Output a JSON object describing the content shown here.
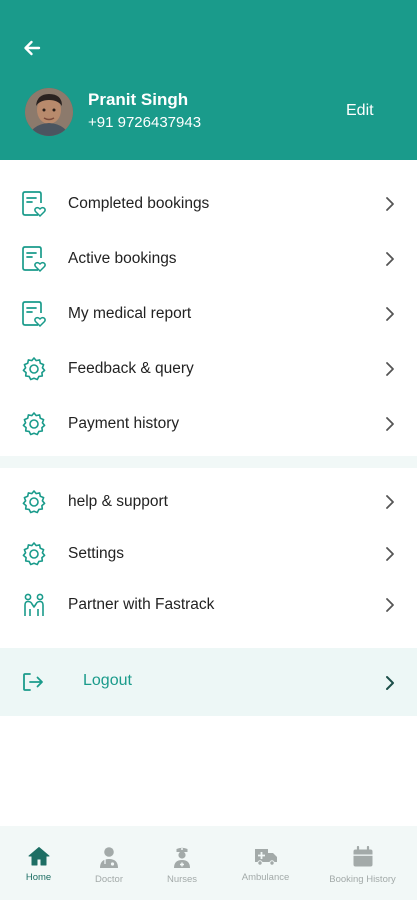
{
  "header": {
    "name": "Pranit Singh",
    "phone": "+91 9726437943",
    "edit_label": "Edit",
    "bg_color": "#1a9b8b"
  },
  "menu_group_1": [
    {
      "label": "Completed bookings",
      "icon": "report-heart-icon"
    },
    {
      "label": "Active bookings",
      "icon": "report-heart-icon"
    },
    {
      "label": "My medical report",
      "icon": "report-heart-icon"
    },
    {
      "label": "Feedback & query",
      "icon": "gear-icon"
    },
    {
      "label": "Payment history",
      "icon": "gear-icon"
    }
  ],
  "menu_group_2": [
    {
      "label": "help & support",
      "icon": "gear-icon"
    },
    {
      "label": "Settings",
      "icon": "gear-icon"
    },
    {
      "label": "Partner with Fastrack",
      "icon": "partners-icon"
    }
  ],
  "logout": {
    "label": "Logout",
    "icon": "logout-icon"
  },
  "bottom_nav": [
    {
      "label": "Home",
      "icon": "home-icon",
      "active": true
    },
    {
      "label": "Doctor",
      "icon": "doctor-icon",
      "active": false
    },
    {
      "label": "Nurses",
      "icon": "nurse-icon",
      "active": false
    },
    {
      "label": "Ambulance",
      "icon": "ambulance-icon",
      "active": false
    },
    {
      "label": "Booking History",
      "icon": "calendar-icon",
      "active": false
    }
  ],
  "colors": {
    "accent": "#1a9b8b",
    "active_nav": "#1d6e64",
    "inactive_nav": "#a3aaa9"
  }
}
